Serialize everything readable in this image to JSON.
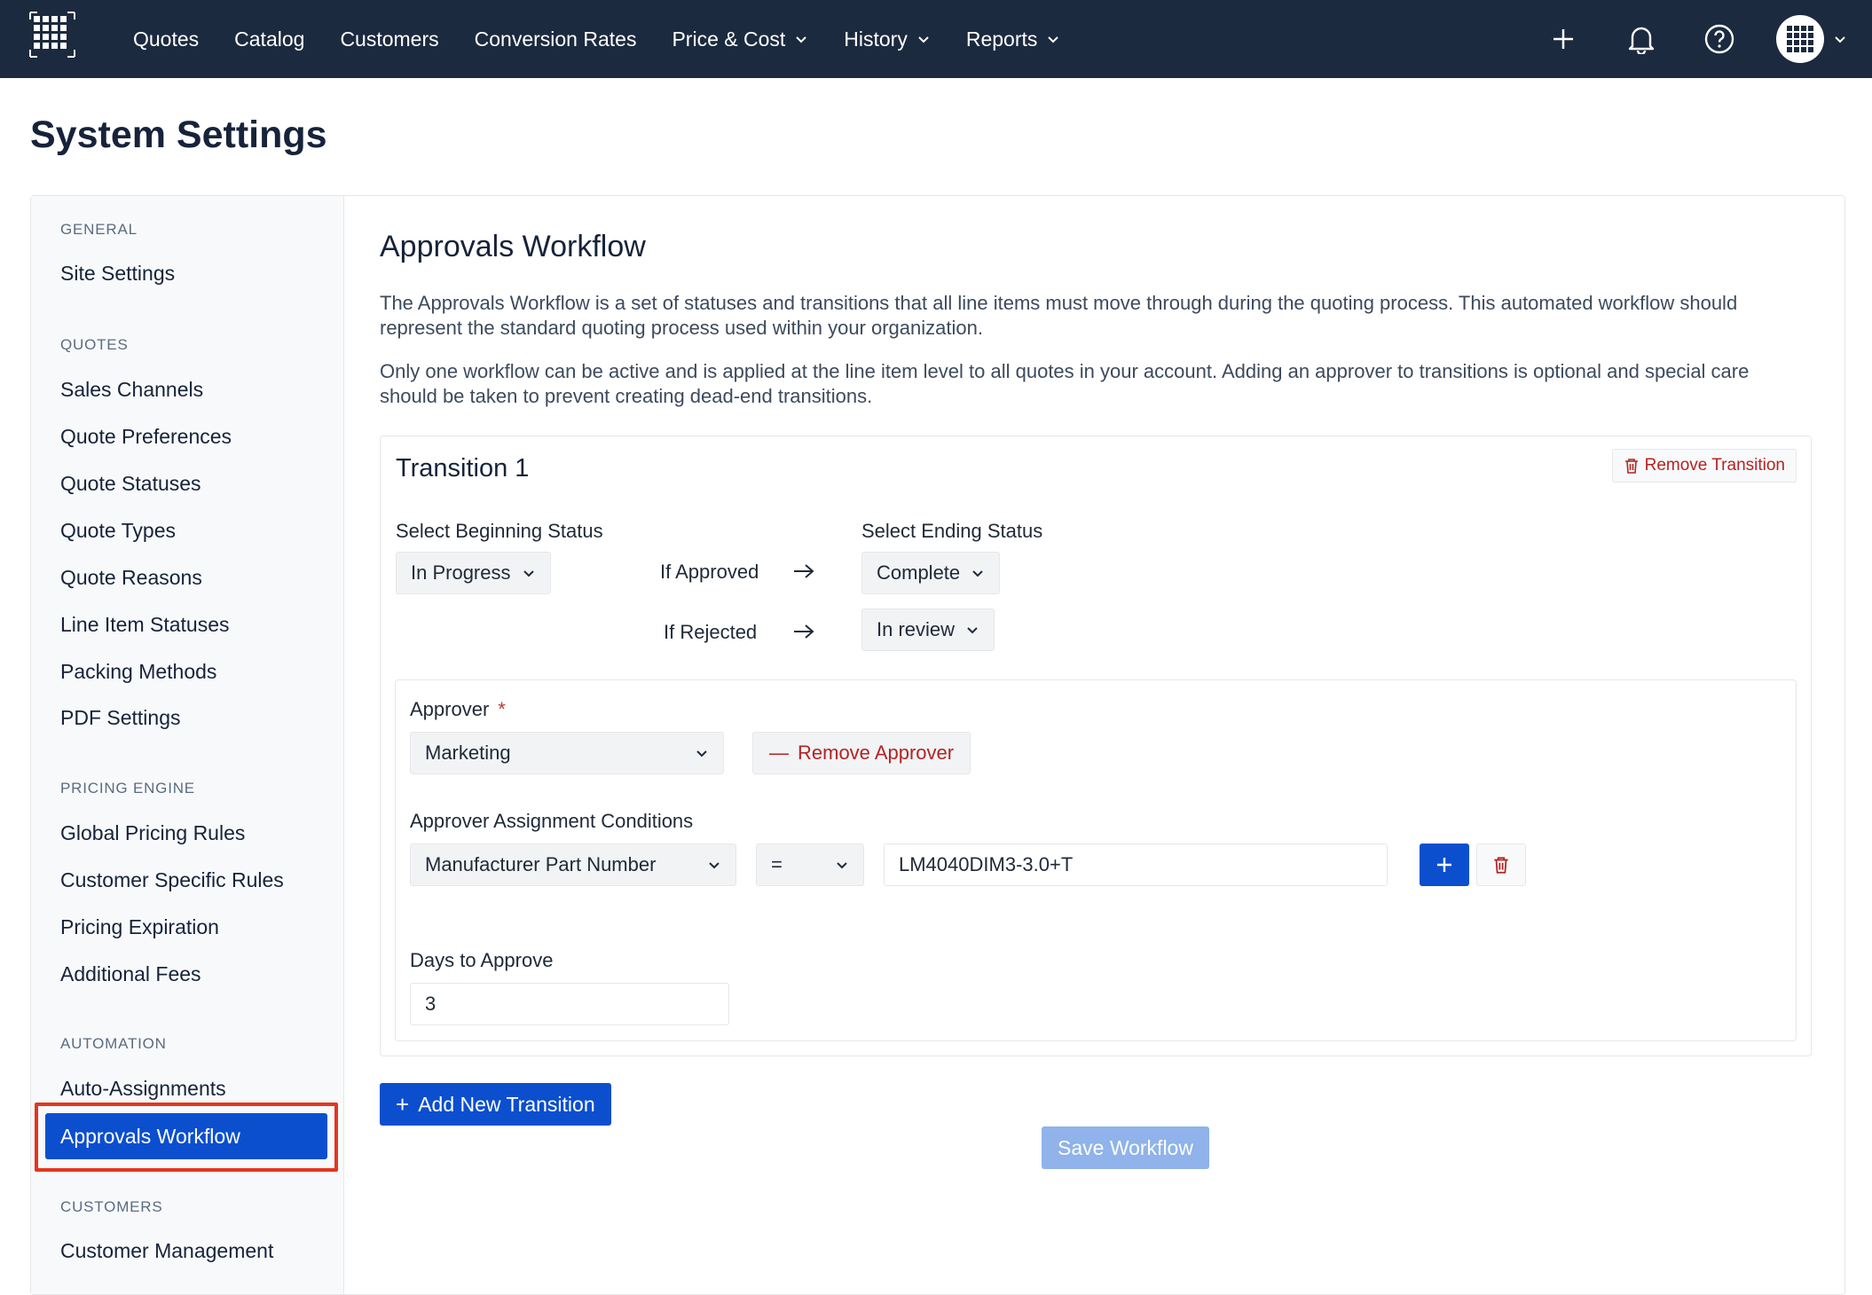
{
  "nav": {
    "items": [
      {
        "label": "Quotes",
        "dropdown": false
      },
      {
        "label": "Catalog",
        "dropdown": false
      },
      {
        "label": "Customers",
        "dropdown": false
      },
      {
        "label": "Conversion Rates",
        "dropdown": false
      },
      {
        "label": "Price & Cost",
        "dropdown": true
      },
      {
        "label": "History",
        "dropdown": true
      },
      {
        "label": "Reports",
        "dropdown": true
      }
    ],
    "icons": [
      "plus-icon",
      "bell-icon",
      "help-icon"
    ]
  },
  "page": {
    "title": "System Settings"
  },
  "sidebar": {
    "sections": [
      {
        "heading": "GENERAL",
        "items": [
          "Site Settings"
        ]
      },
      {
        "heading": "QUOTES",
        "items": [
          "Sales Channels",
          "Quote Preferences",
          "Quote Statuses",
          "Quote Types",
          "Quote Reasons",
          "Line Item Statuses",
          "Packing Methods",
          "PDF Settings"
        ]
      },
      {
        "heading": "PRICING ENGINE",
        "items": [
          "Global Pricing Rules",
          "Customer Specific Rules",
          "Pricing Expiration",
          "Additional Fees"
        ]
      },
      {
        "heading": "AUTOMATION",
        "items": [
          "Auto-Assignments",
          "Approvals Workflow"
        ]
      },
      {
        "heading": "CUSTOMERS",
        "items": [
          "Customer Management"
        ]
      }
    ],
    "active_item": "Approvals Workflow"
  },
  "content": {
    "title": "Approvals Workflow",
    "paragraph1": "The Approvals Workflow is a set of statuses and transitions that all line items must move through during the quoting process. This automated workflow should represent the standard quoting process used within your organization.",
    "paragraph2": "Only one workflow can be active and is applied at the line item level to all quotes in your account. Adding an approver to transitions is optional and special care should be taken to prevent creating dead-end transitions."
  },
  "transition": {
    "title": "Transition 1",
    "remove_label": "Remove Transition",
    "beginning_label": "Select Beginning Status",
    "beginning_value": "In Progress",
    "ending_label": "Select Ending Status",
    "if_approved_label": "If Approved",
    "approved_value": "Complete",
    "if_rejected_label": "If Rejected",
    "rejected_value": "In review",
    "approver": {
      "label": "Approver",
      "required_mark": "*",
      "value": "Marketing",
      "remove_label": "Remove Approver",
      "conditions_label": "Approver Assignment Conditions",
      "condition_field": "Manufacturer Part Number",
      "condition_operator": "=",
      "condition_value": "LM4040DIM3-3.0+T",
      "days_label": "Days to Approve",
      "days_value": "3"
    }
  },
  "actions": {
    "add_transition": "Add New Transition",
    "save_workflow": "Save Workflow"
  },
  "colors": {
    "nav_bg": "#1c2a3f",
    "primary": "#0b4fcf",
    "danger": "#b42323",
    "highlight": "#e3361f"
  }
}
